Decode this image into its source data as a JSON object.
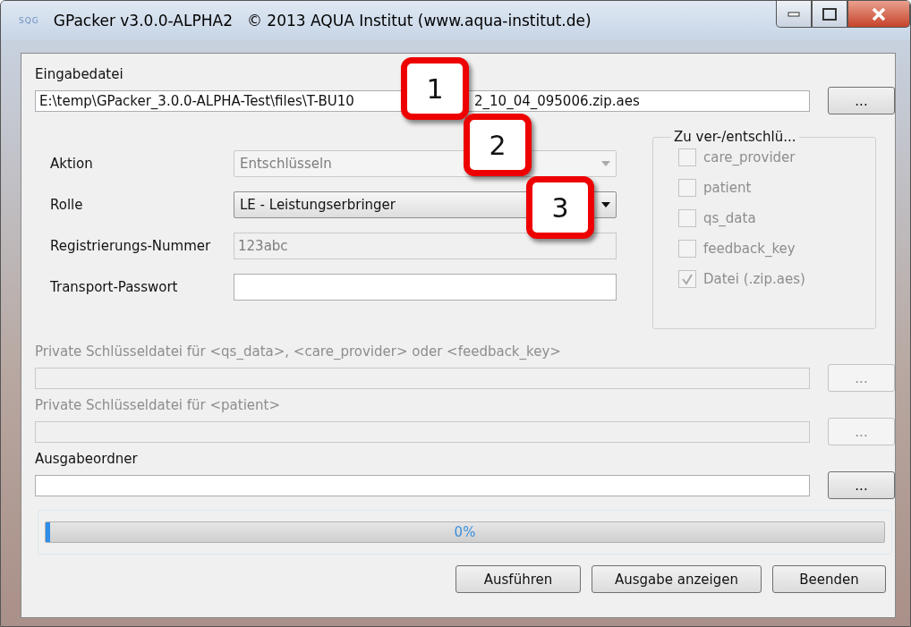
{
  "window": {
    "app_mark": "SQG",
    "title": "GPacker v3.0.0-ALPHA2",
    "copyright": "© 2013 AQUA Institut (www.aqua-institut.de)"
  },
  "input_file": {
    "label": "Eingabedatei",
    "value_parts": [
      "E:\\temp\\GPacker_3.0.0-ALPHA-Test\\files\\T-BU10",
      "2_10_04_095006.zip.aes"
    ],
    "button": "...",
    "disabled": false
  },
  "form": [
    {
      "label": "Aktion",
      "kind": "combo",
      "value": "Entschlüsseln",
      "disabled": true
    },
    {
      "label": "Rolle",
      "kind": "combo",
      "value": "LE - Leistungserbringer",
      "disabled": false
    },
    {
      "label": "Registrierungs-Nummer",
      "kind": "text",
      "value": "123abc",
      "disabled": true
    },
    {
      "label": "Transport-Passwort",
      "kind": "text",
      "disabled": false
    }
  ],
  "group": {
    "title": "Zu ver-/entschlü...",
    "items": [
      {
        "label": "care_provider",
        "checked": false,
        "disabled": true
      },
      {
        "label": "patient",
        "checked": false,
        "disabled": true
      },
      {
        "label": "qs_data",
        "checked": false,
        "disabled": true
      },
      {
        "label": "feedback_key",
        "checked": false,
        "disabled": true
      },
      {
        "label": "Datei (.zip.aes)",
        "checked": true,
        "disabled": true
      }
    ]
  },
  "file_rows": [
    {
      "label": "Private Schlüsseldatei für <qs_data>, <care_provider> oder <feedback_key>",
      "button": "...",
      "disabled": true
    },
    {
      "label": "Private Schlüsseldatei für <patient>",
      "button": "...",
      "disabled": true
    },
    {
      "label": "Ausgabeordner",
      "button": "...",
      "disabled": false
    }
  ],
  "progress": {
    "level": 0.005,
    "text": "0%"
  },
  "buttons": [
    "Ausführen",
    "Ausgabe anzeigen",
    "Beenden"
  ],
  "callouts": [
    "1",
    "2",
    "3"
  ]
}
